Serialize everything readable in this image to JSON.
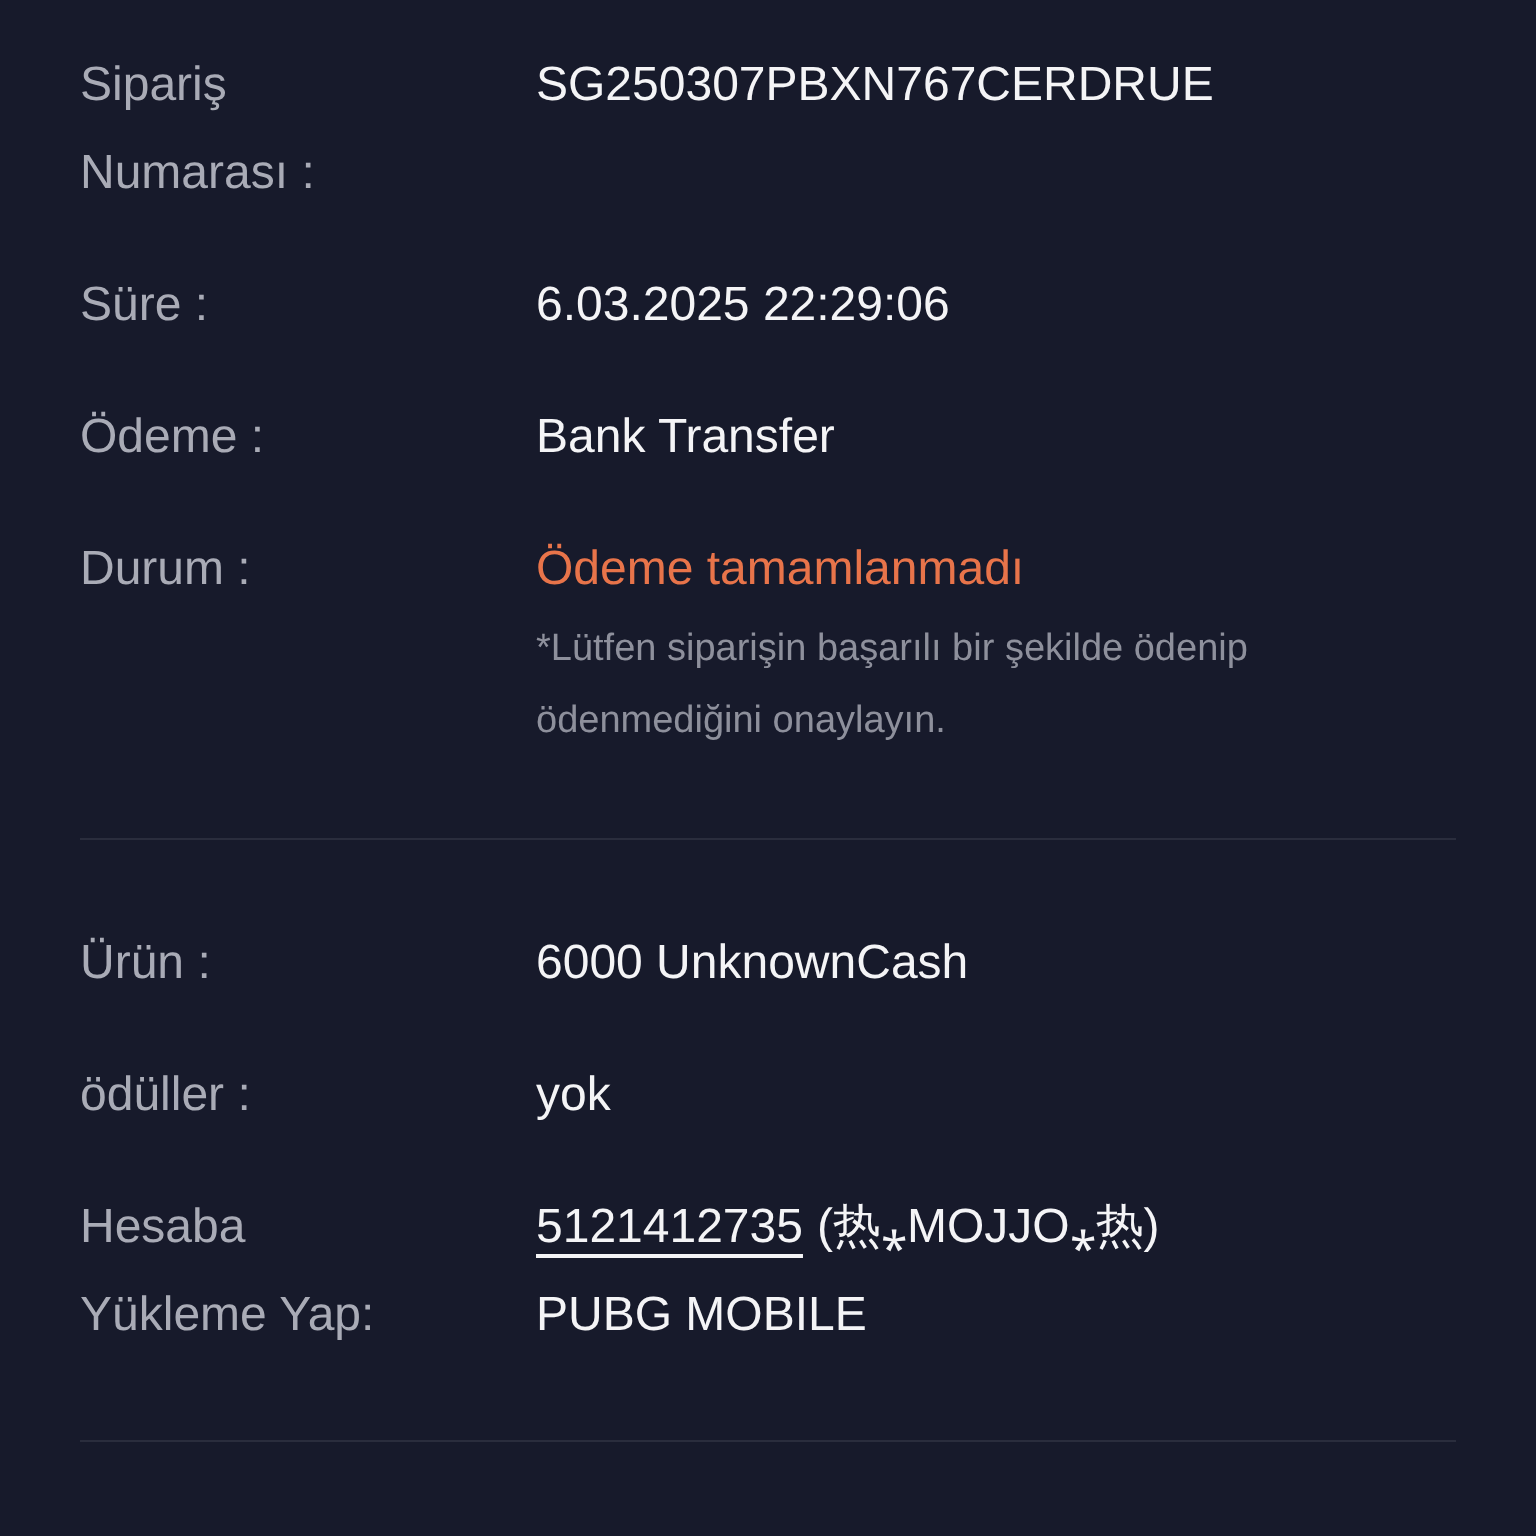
{
  "sections": [
    {
      "rows": [
        {
          "kind": "text",
          "label": "Sipariş Numarası :",
          "value": "SG250307PBXN767CERDRUE"
        },
        {
          "kind": "text",
          "label": "Süre :",
          "value": "6.03.2025 22:29:06"
        },
        {
          "kind": "text",
          "label": "Ödeme :",
          "value": "Bank Transfer"
        },
        {
          "kind": "status",
          "label": "Durum :",
          "value": "Ödeme tamamlanmadı",
          "note": "*Lütfen siparişin başarılı bir şekilde ödenip ödenmediğini onaylayın."
        }
      ]
    },
    {
      "rows": [
        {
          "kind": "text",
          "label": "Ürün :",
          "value": "6000 UnknownCash"
        },
        {
          "kind": "text",
          "label": "ödüller :",
          "value": "yok"
        },
        {
          "kind": "account",
          "label": "Hesaba Yükleme Yap:",
          "account_id": "5121412735",
          "player": "(热⁎MOJJO⁎热)",
          "game": "PUBG MOBILE"
        }
      ]
    }
  ]
}
